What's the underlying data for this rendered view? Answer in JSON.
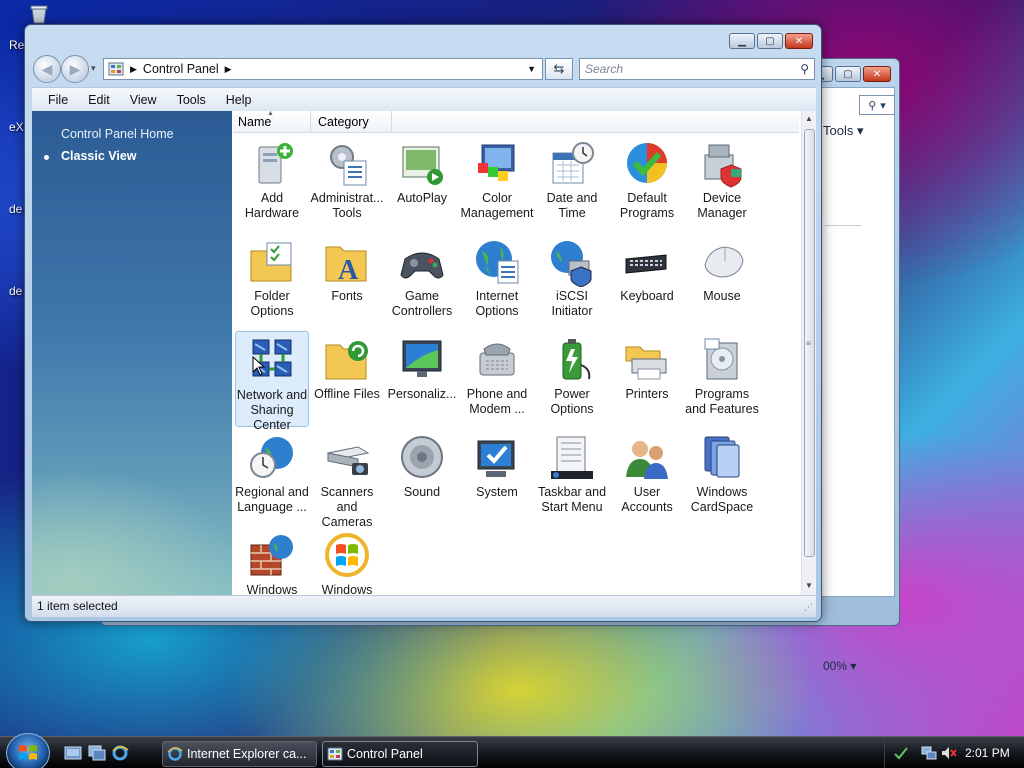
{
  "desktop": {
    "icon_labels": [
      "Re",
      "eX",
      "de",
      "de"
    ]
  },
  "background_window": {
    "toolbar_label": "Tools",
    "zoom": "00%"
  },
  "window": {
    "address": "Control Panel",
    "search_placeholder": "Search",
    "menu": [
      "File",
      "Edit",
      "View",
      "Tools",
      "Help"
    ],
    "sidebar": {
      "home": "Control Panel Home",
      "classic": "Classic View"
    },
    "columns": [
      "Name",
      "Category"
    ],
    "items": [
      {
        "label": "Add Hardware",
        "icon": "add-hardware-icon"
      },
      {
        "label": "Administrat... Tools",
        "icon": "admin-tools-icon"
      },
      {
        "label": "AutoPlay",
        "icon": "autoplay-icon"
      },
      {
        "label": "Color Management",
        "icon": "color-management-icon"
      },
      {
        "label": "Date and Time",
        "icon": "date-time-icon"
      },
      {
        "label": "Default Programs",
        "icon": "default-programs-icon"
      },
      {
        "label": "Device Manager",
        "icon": "device-manager-icon"
      },
      {
        "label": "Folder Options",
        "icon": "folder-options-icon"
      },
      {
        "label": "Fonts",
        "icon": "fonts-icon"
      },
      {
        "label": "Game Controllers",
        "icon": "game-controllers-icon"
      },
      {
        "label": "Internet Options",
        "icon": "internet-options-icon"
      },
      {
        "label": "iSCSI Initiator",
        "icon": "iscsi-icon"
      },
      {
        "label": "Keyboard",
        "icon": "keyboard-icon"
      },
      {
        "label": "Mouse",
        "icon": "mouse-icon"
      },
      {
        "label": "Network and Sharing Center",
        "icon": "network-icon",
        "selected": true
      },
      {
        "label": "Offline Files",
        "icon": "offline-files-icon"
      },
      {
        "label": "Personaliz...",
        "icon": "personalization-icon"
      },
      {
        "label": "Phone and Modem ...",
        "icon": "phone-modem-icon"
      },
      {
        "label": "Power Options",
        "icon": "power-options-icon"
      },
      {
        "label": "Printers",
        "icon": "printers-icon"
      },
      {
        "label": "Programs and Features",
        "icon": "programs-features-icon"
      },
      {
        "label": "Regional and Language ...",
        "icon": "regional-icon"
      },
      {
        "label": "Scanners and Cameras",
        "icon": "scanners-icon"
      },
      {
        "label": "Sound",
        "icon": "sound-icon"
      },
      {
        "label": "System",
        "icon": "system-icon"
      },
      {
        "label": "Taskbar and Start Menu",
        "icon": "taskbar-icon"
      },
      {
        "label": "User Accounts",
        "icon": "user-accounts-icon"
      },
      {
        "label": "Windows CardSpace",
        "icon": "cardspace-icon"
      },
      {
        "label": "Windows",
        "icon": "windows-firewall-icon"
      },
      {
        "label": "Windows",
        "icon": "windows-update-icon"
      }
    ],
    "status": "1 item selected"
  },
  "taskbar": {
    "tasks": [
      {
        "label": "Internet Explorer ca...",
        "active": false
      },
      {
        "label": "Control Panel",
        "active": true
      }
    ],
    "clock": "2:01 PM"
  }
}
